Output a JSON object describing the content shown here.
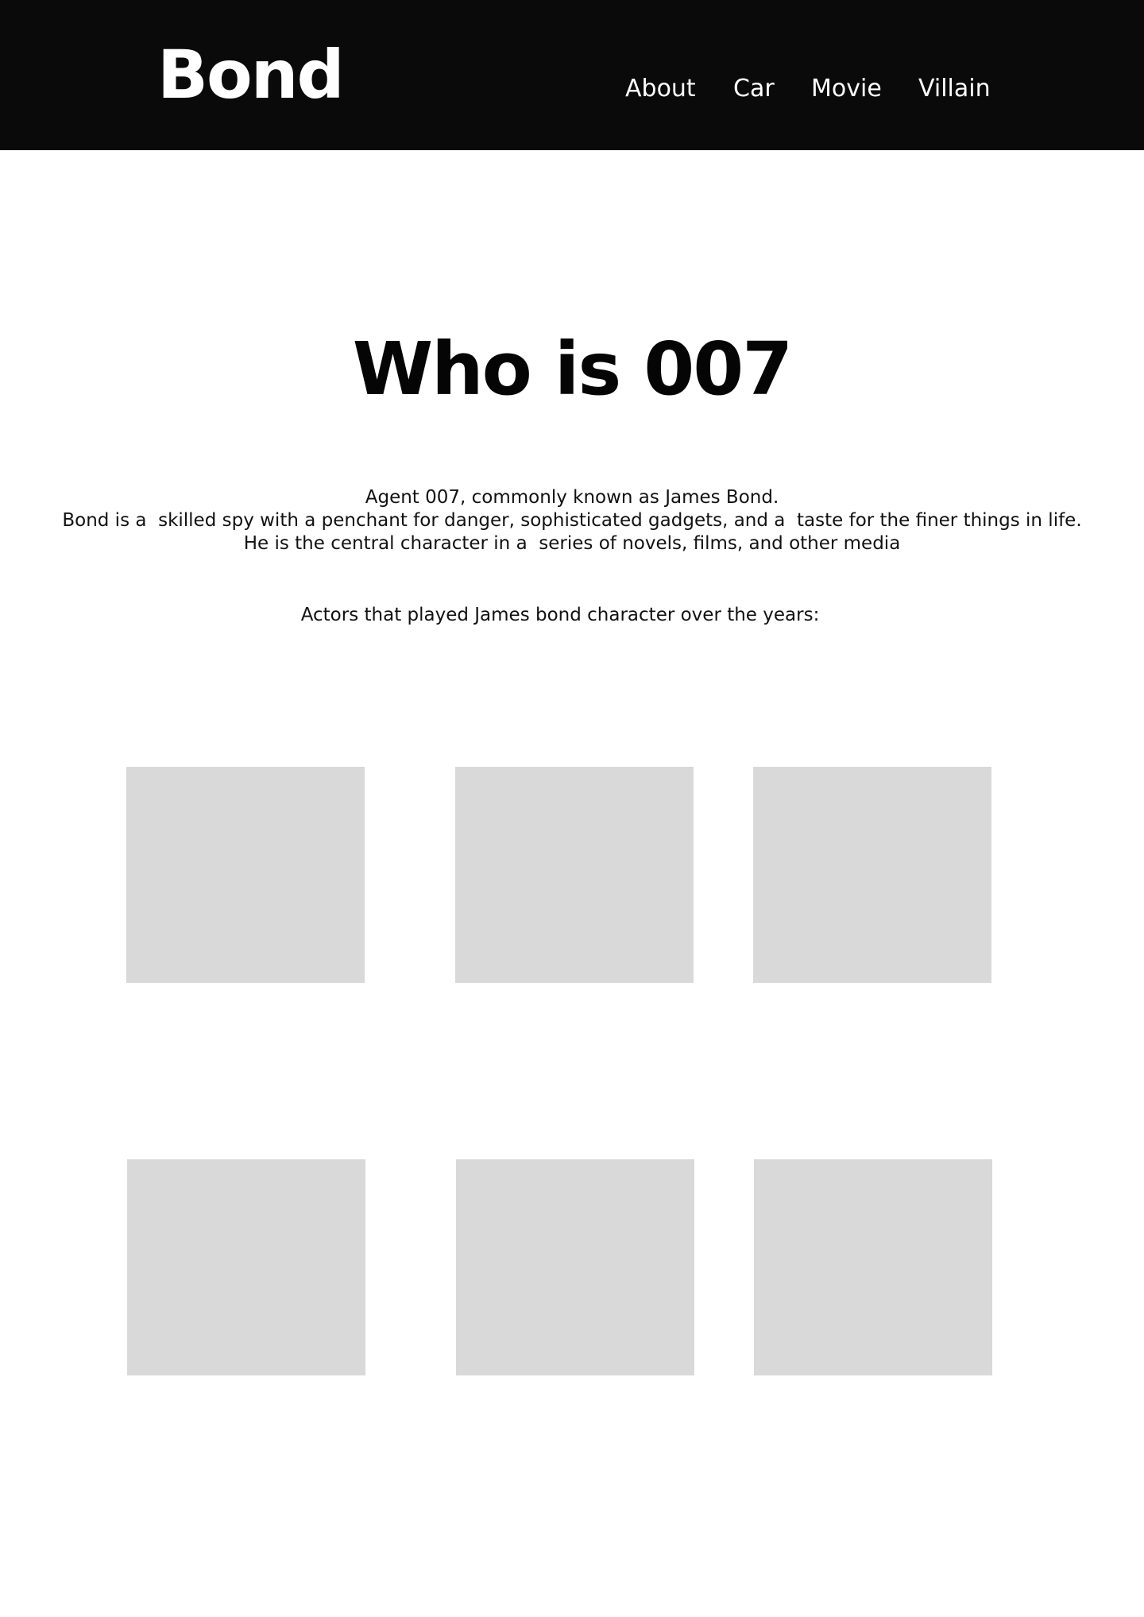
{
  "header": {
    "logo": "Bond",
    "nav": [
      {
        "label": "About"
      },
      {
        "label": "Car"
      },
      {
        "label": "Movie"
      },
      {
        "label": "Villain"
      }
    ]
  },
  "main": {
    "title": "Who is 007",
    "intro_lines": [
      "Agent 007, commonly known as James Bond.",
      "Bond is a  skilled spy with a penchant for danger, sophisticated gadgets, and a  taste for the finer things in life.",
      "He is the central character in a  series of novels, films, and other media"
    ],
    "actors_lead": "Actors that played James bond character over the years:"
  }
}
